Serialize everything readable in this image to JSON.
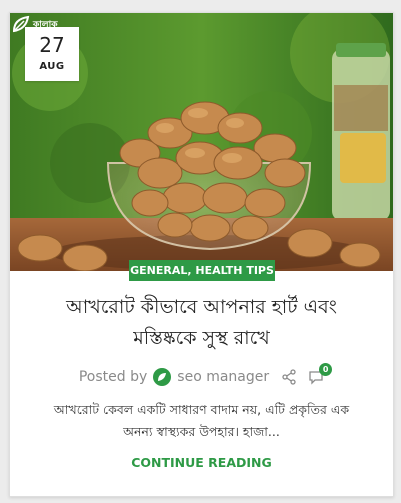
{
  "brand": {
    "logo_text": "কালাক"
  },
  "post": {
    "date_day": "27",
    "date_month": "AUG",
    "category": "GENERAL, HEALTH TIPS",
    "title_line1": "আখরোট কীভাবে আপনার হার্ট এবং",
    "title_line2": "মস্তিষ্ককে সুস্থ রাখে",
    "posted_by_label": "Posted by",
    "author": "seo manager",
    "comment_count": "0",
    "excerpt_line1": "আখরোট কেবল একটি সাধারণ বাদাম নয়, এটি প্রকৃতির এক",
    "excerpt_line2": "অনন্য স্বাস্থ্যকর উপহার। হাজা...",
    "read_more": "CONTINUE READING"
  },
  "colors": {
    "accent": "#2e9a46",
    "title": "#222222",
    "meta": "#8a8a8a"
  },
  "icons": {
    "share": "share-icon",
    "comment": "comment-icon",
    "avatar": "author-avatar-icon"
  }
}
